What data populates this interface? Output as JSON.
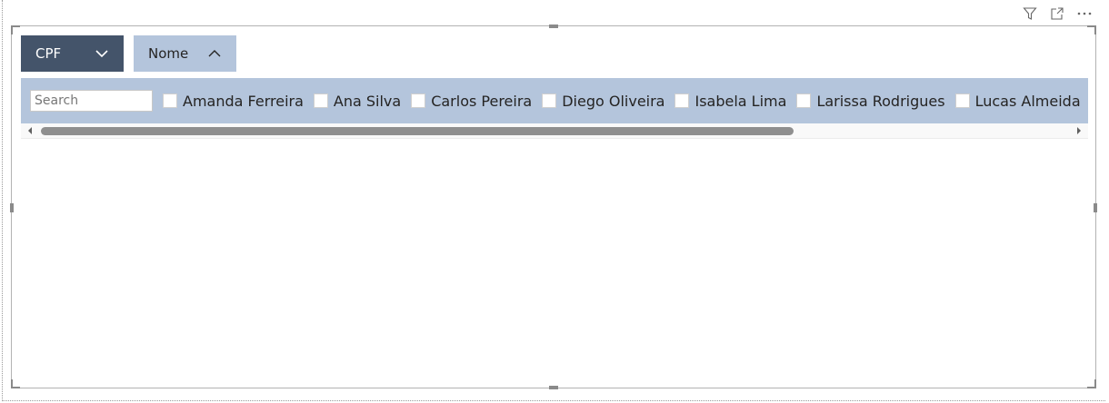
{
  "header_icons": [
    {
      "name": "filter-icon"
    },
    {
      "name": "focus-mode-icon"
    },
    {
      "name": "more-options-icon"
    }
  ],
  "slicer": {
    "tabs": [
      {
        "label": "CPF",
        "icon": "chevron-down-icon",
        "active": true
      },
      {
        "label": "Nome",
        "icon": "chevron-up-icon",
        "active": false
      }
    ],
    "search": {
      "placeholder": "Search",
      "value": ""
    },
    "items": [
      {
        "label": "Amanda Ferreira",
        "checked": false
      },
      {
        "label": "Ana Silva",
        "checked": false
      },
      {
        "label": "Carlos Pereira",
        "checked": false
      },
      {
        "label": "Diego Oliveira",
        "checked": false
      },
      {
        "label": "Isabela Lima",
        "checked": false
      },
      {
        "label": "Larissa Rodrigues",
        "checked": false
      },
      {
        "label": "Lucas Almeida",
        "checked": false
      },
      {
        "label": "",
        "checked": false
      }
    ]
  },
  "colors": {
    "active_tab": "#44546a",
    "inactive_tab": "#b4c5dc",
    "band": "#b4c5dc",
    "scroll_thumb": "#8f8f8f"
  }
}
